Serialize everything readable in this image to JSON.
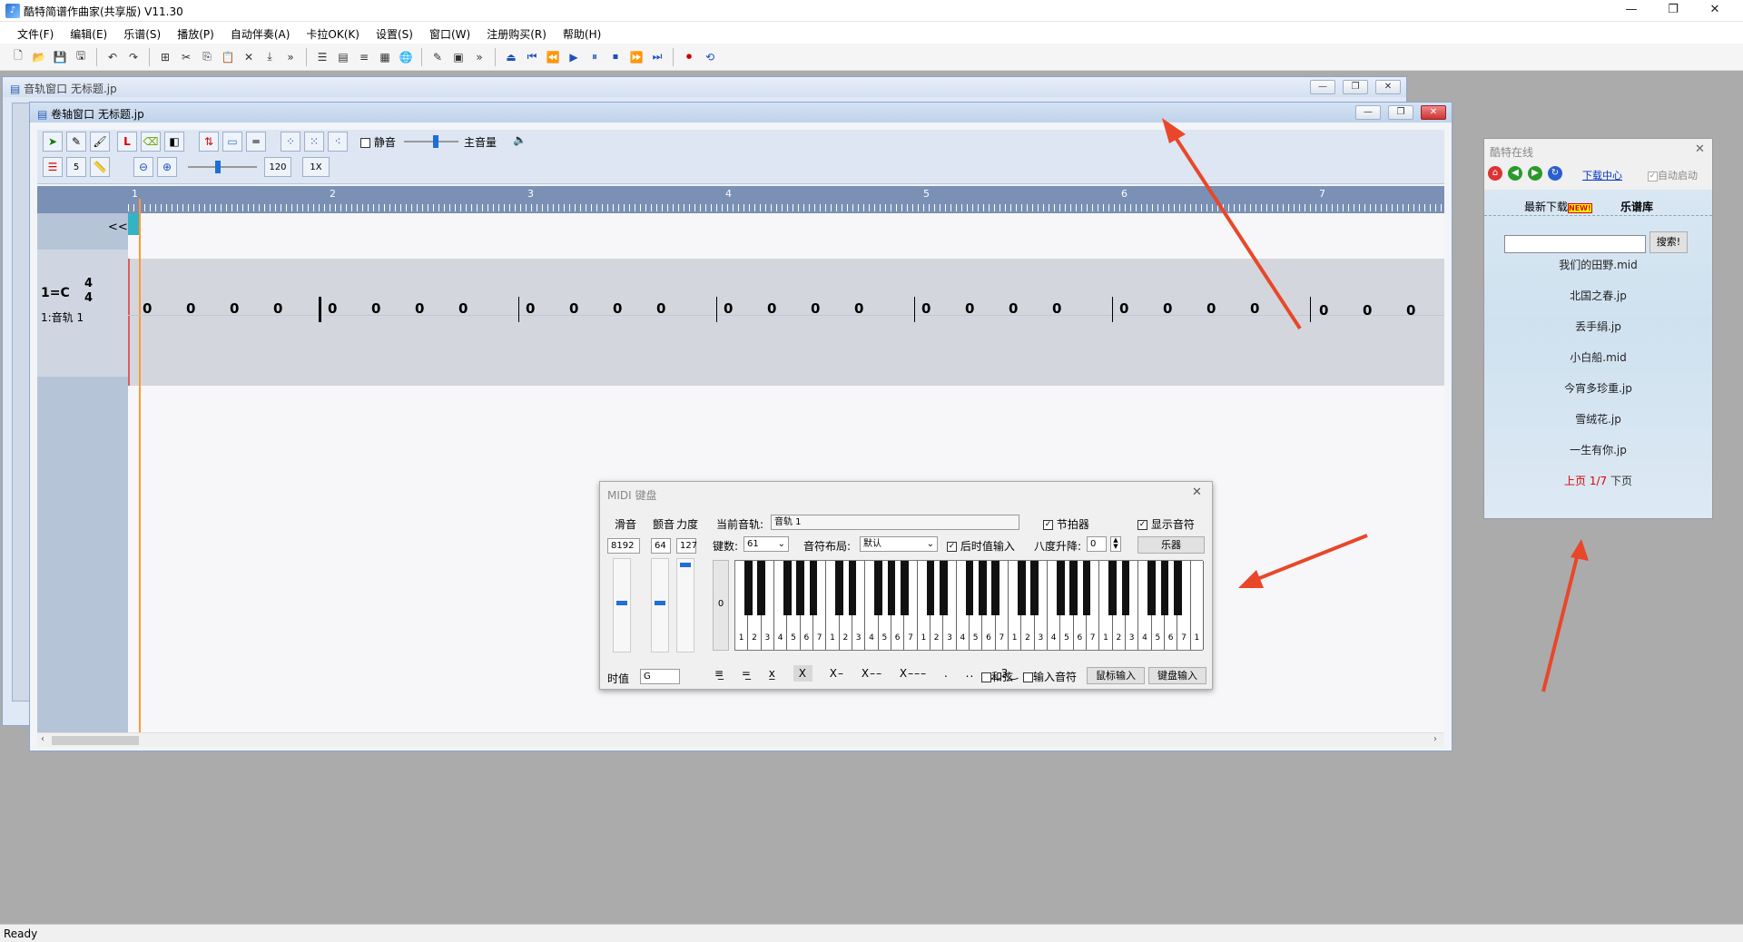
{
  "app": {
    "title": "酷特简谱作曲家(共享版) V11.30"
  },
  "menu": [
    "文件(F)",
    "编辑(E)",
    "乐谱(S)",
    "播放(P)",
    "自动伴奏(A)",
    "卡拉OK(K)",
    "设置(S)",
    "窗口(W)",
    "注册购买(R)",
    "帮助(H)"
  ],
  "track_window": {
    "title": "音轨窗口  无标题.jp"
  },
  "roll_window": {
    "title": "卷轴窗口  无标题.jp",
    "mute_label": "静音",
    "master_volume_label": "主音量",
    "value_5": "5",
    "tempo": "120",
    "speed": "1X",
    "ruler_marks": [
      "1",
      "2",
      "3",
      "4",
      "5",
      "6",
      "7"
    ],
    "collapse": "<<",
    "key": "1=C",
    "time_sig_top": "4",
    "time_sig_bottom": "4",
    "track_label": "1:音轨 1",
    "notes": [
      "0",
      "0",
      "0",
      "0",
      "0",
      "0",
      "0",
      "0",
      "0",
      "0",
      "0",
      "0",
      "0",
      "0",
      "0",
      "0",
      "0",
      "0",
      "0",
      "0",
      "0",
      "0",
      "0",
      "0",
      "0",
      "0",
      "0"
    ]
  },
  "midi": {
    "title": "MIDI 键盘",
    "pitch_label": "滑音",
    "mod_label": "颤音",
    "vel_label": "力度",
    "pitch_val": "8192",
    "mod_val": "64",
    "vel_val": "127",
    "zero": "0",
    "cur_track_label": "当前音轨:",
    "cur_track_val": "音轨 1",
    "metronome": "节拍器",
    "show_notes": "显示音符",
    "keys_label": "键数:",
    "keys_val": "61",
    "layout_label": "音符布局:",
    "layout_val": "默认",
    "post_input": "后时值输入",
    "octave_label": "八度升降:",
    "octave_val": "0",
    "instrument_btn": "乐器",
    "duration_label": "时值",
    "duration_val": "G",
    "chord": "和弦",
    "input_note": "输入音符",
    "mouse_input": "鼠标输入",
    "keyboard_input": "键盘输入",
    "key_digits": "1234567"
  },
  "online": {
    "title": "酷特在线",
    "download_center": "下载中心",
    "auto_start": "自动启动",
    "tab_latest": "最新下载",
    "new_badge": "NEW!",
    "tab_library": "乐谱库",
    "search_btn": "搜索!",
    "songs": [
      "我们的田野.mid",
      "北国之春.jp",
      "丢手绢.jp",
      "小白船.mid",
      "今宵多珍重.jp",
      "雪绒花.jp",
      "一生有你.jp"
    ],
    "prev": "上页",
    "page": "1/7",
    "next": "下页"
  },
  "status": {
    "text": "Ready"
  },
  "colors": {
    "arrow": "#e8472a",
    "ruler": "#7a90b5",
    "playhead": "#ff9933"
  }
}
